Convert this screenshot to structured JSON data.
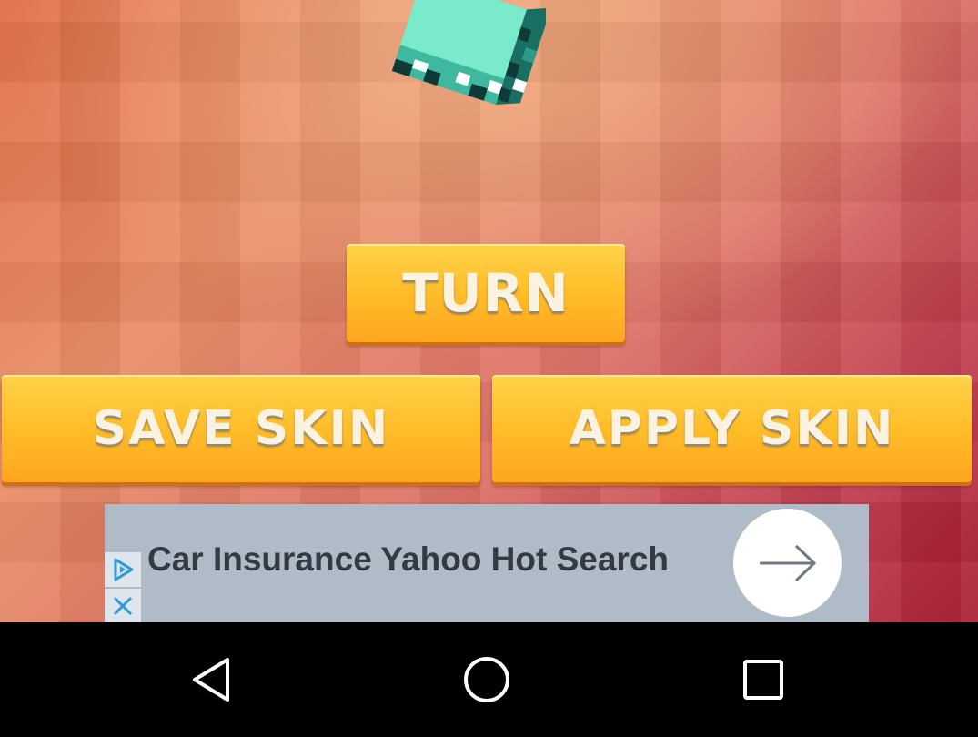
{
  "game": {
    "turn_button": "TURN",
    "save_button": "SAVE SKIN",
    "apply_button": "APPLY SKIN"
  },
  "ad": {
    "text": "Car Insurance Yahoo Hot Search",
    "arrow_icon": "arrow-right-icon",
    "play_icon": "ad-choices-icon",
    "close_icon": "close-icon"
  },
  "nav": {
    "back_icon": "back-triangle-icon",
    "home_icon": "home-circle-icon",
    "recent_icon": "recents-square-icon"
  },
  "colors": {
    "button_yellow": "#ffbe2a",
    "button_text": "#fbf3e0",
    "ad_background": "#afbbc7",
    "skin_teal": "#76e8c8"
  }
}
